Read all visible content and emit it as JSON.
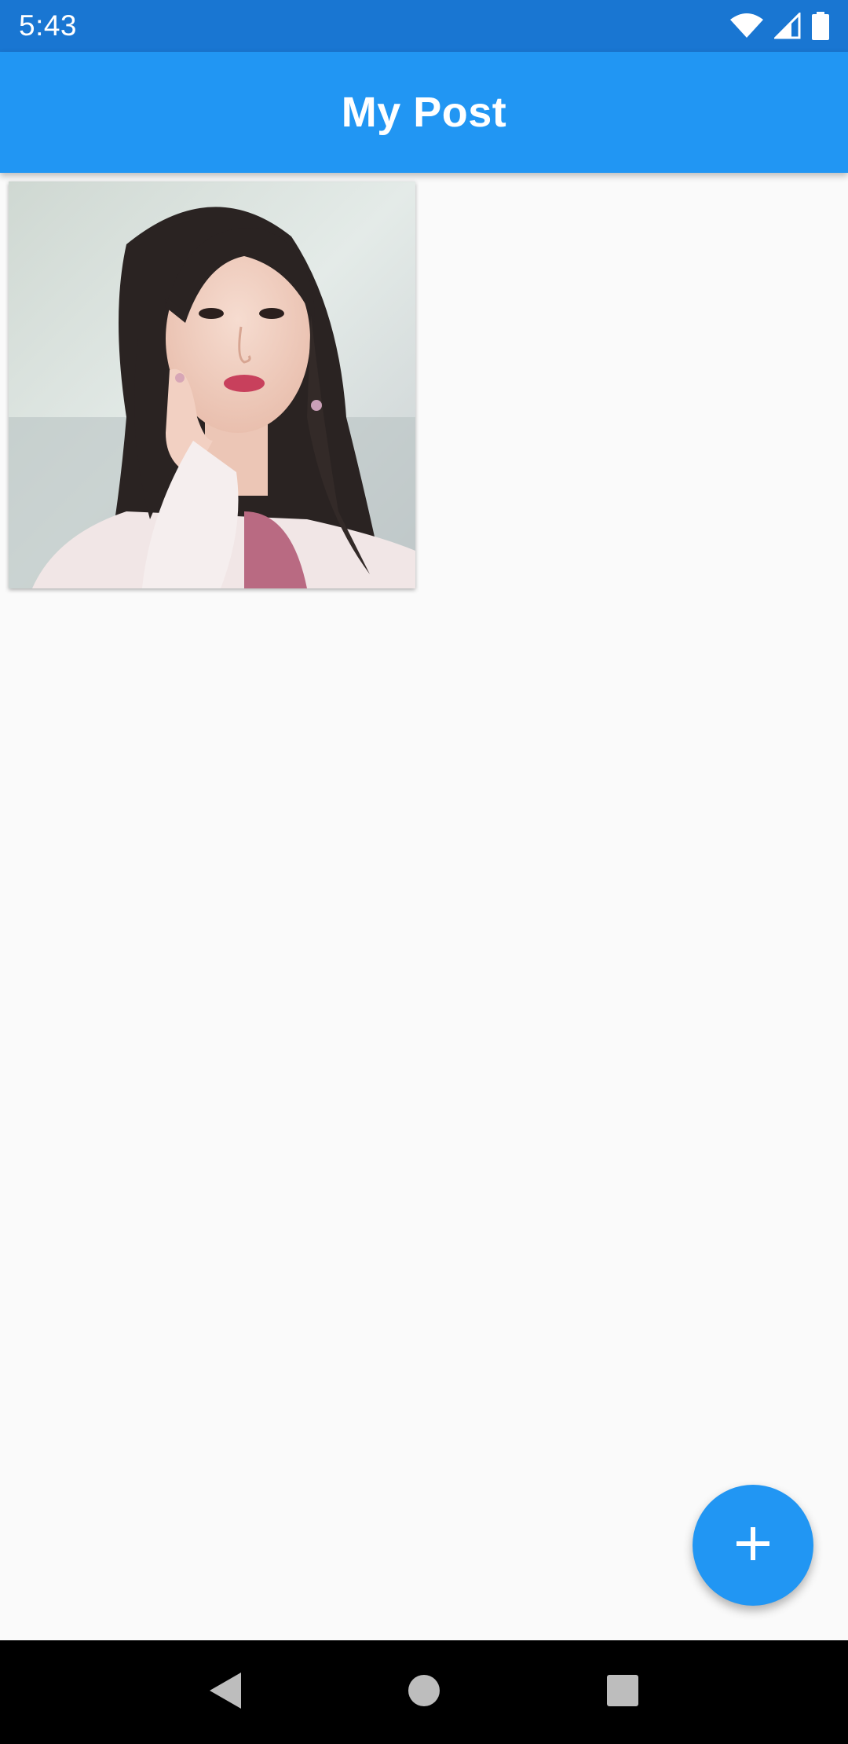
{
  "status_bar": {
    "time": "5:43",
    "icons": [
      "wifi-icon",
      "cellular-signal-icon",
      "battery-icon"
    ]
  },
  "app_bar": {
    "title": "My Post"
  },
  "posts": [
    {
      "image": "portrait-photo-woman-long-dark-hair"
    }
  ],
  "fab": {
    "icon": "plus-icon"
  },
  "nav_bar": {
    "icons": [
      "back-icon",
      "home-icon",
      "recents-icon"
    ]
  },
  "colors": {
    "primary": "#2196f3",
    "primary_dark": "#1976d2",
    "background": "#fafafa"
  }
}
